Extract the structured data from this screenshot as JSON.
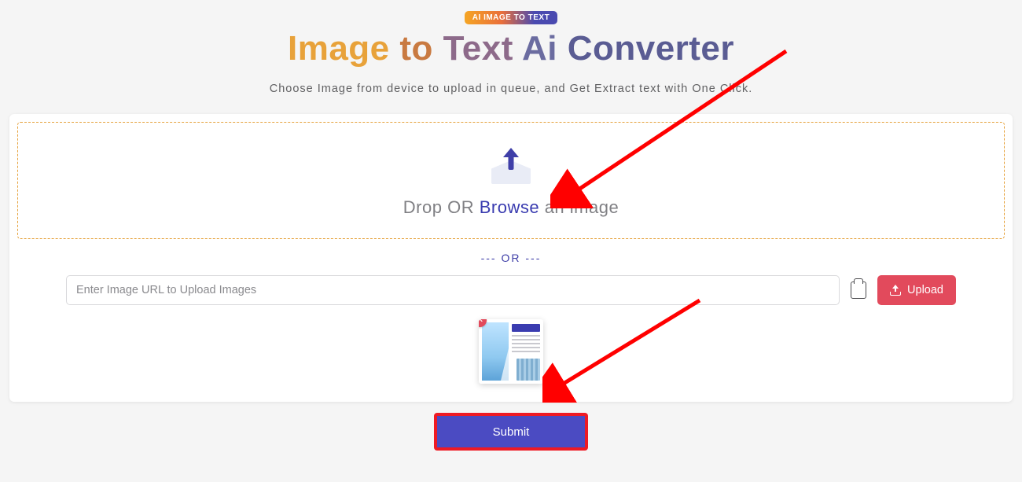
{
  "badge": "AI IMAGE TO TEXT",
  "title": {
    "w1": "Image",
    "w2": "to",
    "w3": "Text",
    "w4": "Ai",
    "w5": "Converter"
  },
  "subtitle": "Choose Image from device to upload in queue, and Get Extract text with One Click.",
  "dropzone": {
    "drop": "Drop OR ",
    "browse": "Browse",
    "rest": " an image"
  },
  "or_divider": "--- OR ---",
  "url_placeholder": "Enter Image URL to Upload Images",
  "upload_label": "Upload",
  "submit_label": "Submit",
  "thumb_close": "✕"
}
